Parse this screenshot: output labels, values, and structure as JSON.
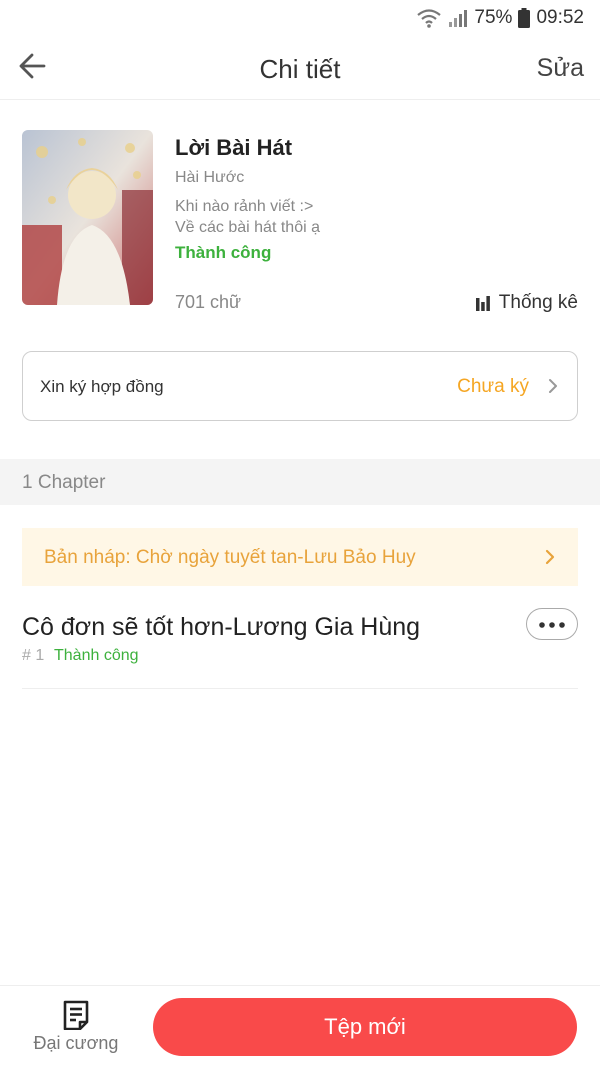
{
  "status_bar": {
    "battery": "75%",
    "time": "09:52",
    "icons": [
      "wifi-icon",
      "signal-icon",
      "battery-icon"
    ]
  },
  "header": {
    "title": "Chi tiết",
    "edit_label": "Sửa",
    "back_icon": "arrow-left-icon"
  },
  "book": {
    "title": "Lời Bài Hát",
    "genre": "Hài Hước",
    "description_line1": "Khi nào rảnh viết :>",
    "description_line2": "Về các bài hát thôi ạ",
    "status": "Thành công",
    "word_count": "701 chữ",
    "stats_label": "Thống kê"
  },
  "contract": {
    "label": "Xin ký hợp đồng",
    "status": "Chưa ký"
  },
  "chapters": {
    "count_label": "1 Chapter",
    "draft_label": "Bản nháp: Chờ ngày tuyết tan-Lưu Bảo Huy",
    "items": [
      {
        "title": "Cô đơn sẽ tốt hơn-Lương Gia Hùng",
        "number": "# 1",
        "status": "Thành công"
      }
    ]
  },
  "bottom": {
    "outline_label": "Đại cương",
    "new_button_label": "Tệp mới"
  },
  "colors": {
    "accent_red": "#f94a4a",
    "success_green": "#3db13d",
    "warning_orange": "#f5a623",
    "draft_background": "#fff7e6"
  }
}
